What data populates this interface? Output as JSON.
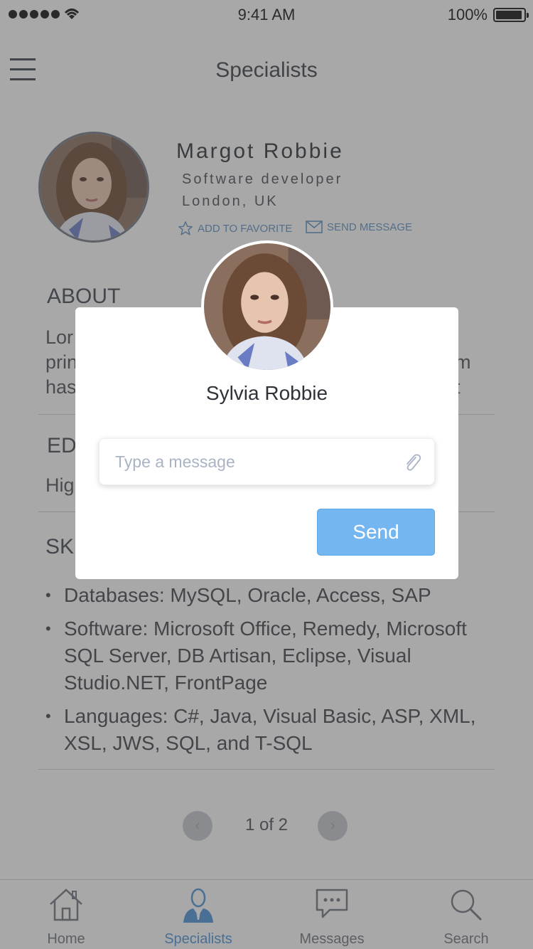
{
  "status_bar": {
    "time": "9:41 AM",
    "battery": "100%"
  },
  "header": {
    "title": "Specialists"
  },
  "profile": {
    "name": "Margot Robbie",
    "job": "Software developer",
    "location": "London, UK",
    "favorite_label": "ADD TO FAVORITE",
    "message_label": "SEND MESSAGE"
  },
  "about": {
    "title": "ABOUT",
    "lines": [
      "Lor",
      "prin",
      "has"
    ],
    "right_lines": [
      "m",
      "t"
    ]
  },
  "education": {
    "title": "ED",
    "text": "Hig"
  },
  "skills": {
    "title": "SK",
    "items": [
      "Databases: MySQL, Oracle, Access, SAP",
      "Software: Microsoft Office, Remedy, Microsoft SQL Server, DB Artisan, Eclipse, Visual Studio.NET, FrontPage",
      "Languages: C#, Java, Visual Basic, ASP, XML, XSL, JWS, SQL, and T-SQL"
    ]
  },
  "pager": {
    "text": "1 of 2",
    "prev": "‹",
    "next": "›"
  },
  "tabs": [
    {
      "label": "Home",
      "icon": "home-icon"
    },
    {
      "label": "Specialists",
      "icon": "specialist-icon",
      "active": true
    },
    {
      "label": "Messages",
      "icon": "messages-icon"
    },
    {
      "label": "Search",
      "icon": "search-icon"
    }
  ],
  "modal": {
    "name": "Sylvia Robbie",
    "placeholder": "Type a message",
    "send_label": "Send"
  },
  "colors": {
    "accent": "#4a90d6",
    "send_button": "#74b6f0",
    "overlay": "#484848"
  }
}
